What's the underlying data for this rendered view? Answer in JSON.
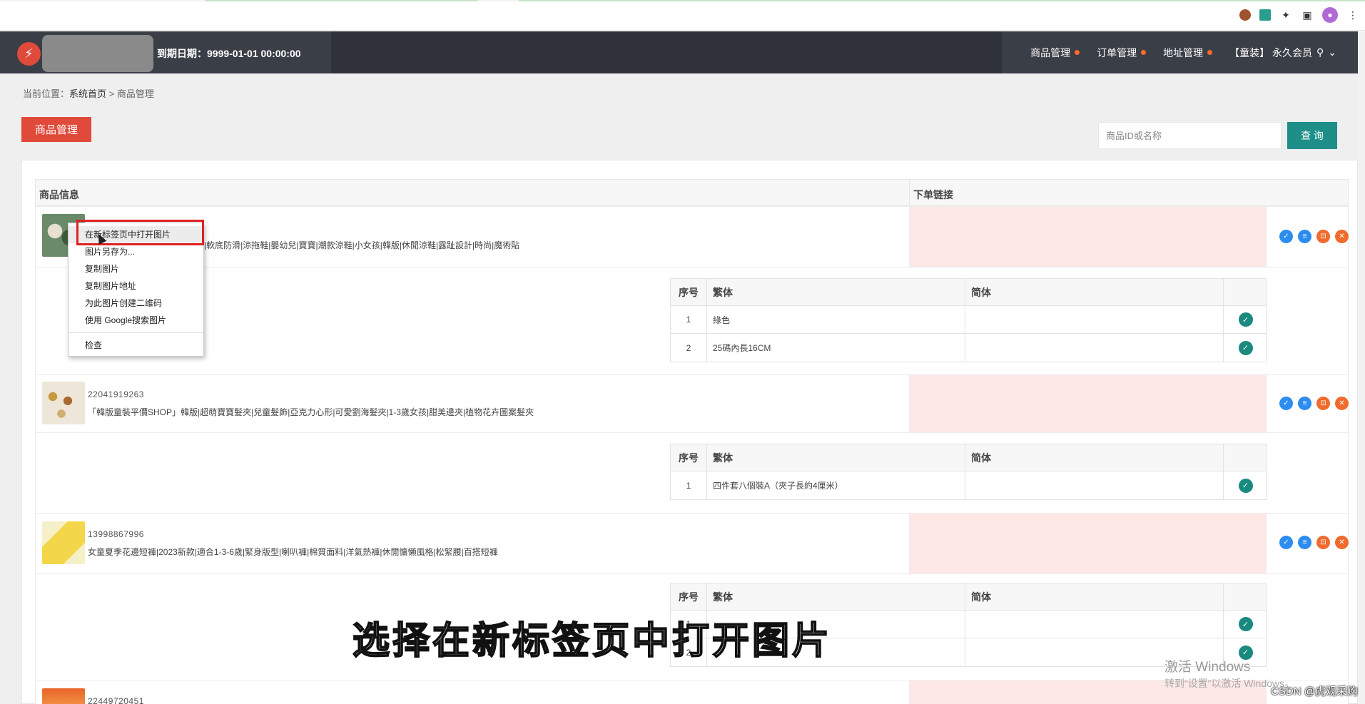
{
  "app": {
    "logo_glyph": "⚡",
    "expire_text": "到期日期：9999-01-01 00:00:00",
    "nav": [
      {
        "label": "商品管理"
      },
      {
        "label": "订单管理"
      },
      {
        "label": "地址管理"
      }
    ],
    "user": "【童装】 永久会员"
  },
  "breadcrumb": {
    "prefix": "当前位置：",
    "home": "系统首页",
    "sep": ">",
    "current": "商品管理"
  },
  "page": {
    "title_button": "商品管理",
    "search_placeholder": "商品ID或名称",
    "search_button": "查 询"
  },
  "table": {
    "col_info": "商品信息",
    "col_link": "下单链接",
    "sub_headers": {
      "index": "序号",
      "traditional": "繁体",
      "simplified": "简体"
    },
    "products": [
      {
        "name_partial": "|軟底防滑|涼拖鞋|嬰幼兒|寶寶|潮款涼鞋|小女孩|韓版|休閒涼鞋|露趾設計|時尚|魔術貼",
        "options": [
          {
            "index": "1",
            "traditional": "綠色",
            "simplified": ""
          },
          {
            "index": "2",
            "traditional": "25碼內長16CM",
            "simplified": ""
          }
        ]
      },
      {
        "id": "22041919263",
        "name": "「韓版童裝平價SHOP」韓版|超萌寶寶髮夾|兒童髮飾|亞克力心形|可愛劉海髮夾|1-3歲女孩|甜美邊夾|植物花卉圖案髮夾",
        "options": [
          {
            "index": "1",
            "traditional": "四件套八個裝A（夾子長約4厘米）",
            "simplified": ""
          }
        ]
      },
      {
        "id": "13998867996",
        "name": "女童夏季花邊短褲|2023新款|適合1-3-6歲|緊身版型|喇叭褲|棉質面料|洋氣熱褲|休閒慵懶風格|松緊腰|百搭短褲",
        "options": [
          {
            "index": "1",
            "traditional": "",
            "simplified": ""
          },
          {
            "index": "2",
            "traditional": "",
            "simplified": ""
          }
        ]
      },
      {
        "id": "22449720451"
      }
    ]
  },
  "context_menu": {
    "items": [
      "在新标签页中打开图片",
      "图片另存为...",
      "复制图片",
      "复制图片地址",
      "为此图片创建二维码",
      "使用 Google搜索图片"
    ],
    "inspect": "检查"
  },
  "overlay": {
    "subtitle": "选择在新标签页中打开图片",
    "win_watermark": "激活 Windows",
    "win_watermark_sub": "转到“设置”以激活 Windows。",
    "csdn": "CSDN @虎观采购"
  },
  "colors": {
    "accent_red": "#e04a3a",
    "teal": "#1e8e89",
    "header_dark": "#2f3238",
    "link_cell_pink": "#fde8e6"
  }
}
